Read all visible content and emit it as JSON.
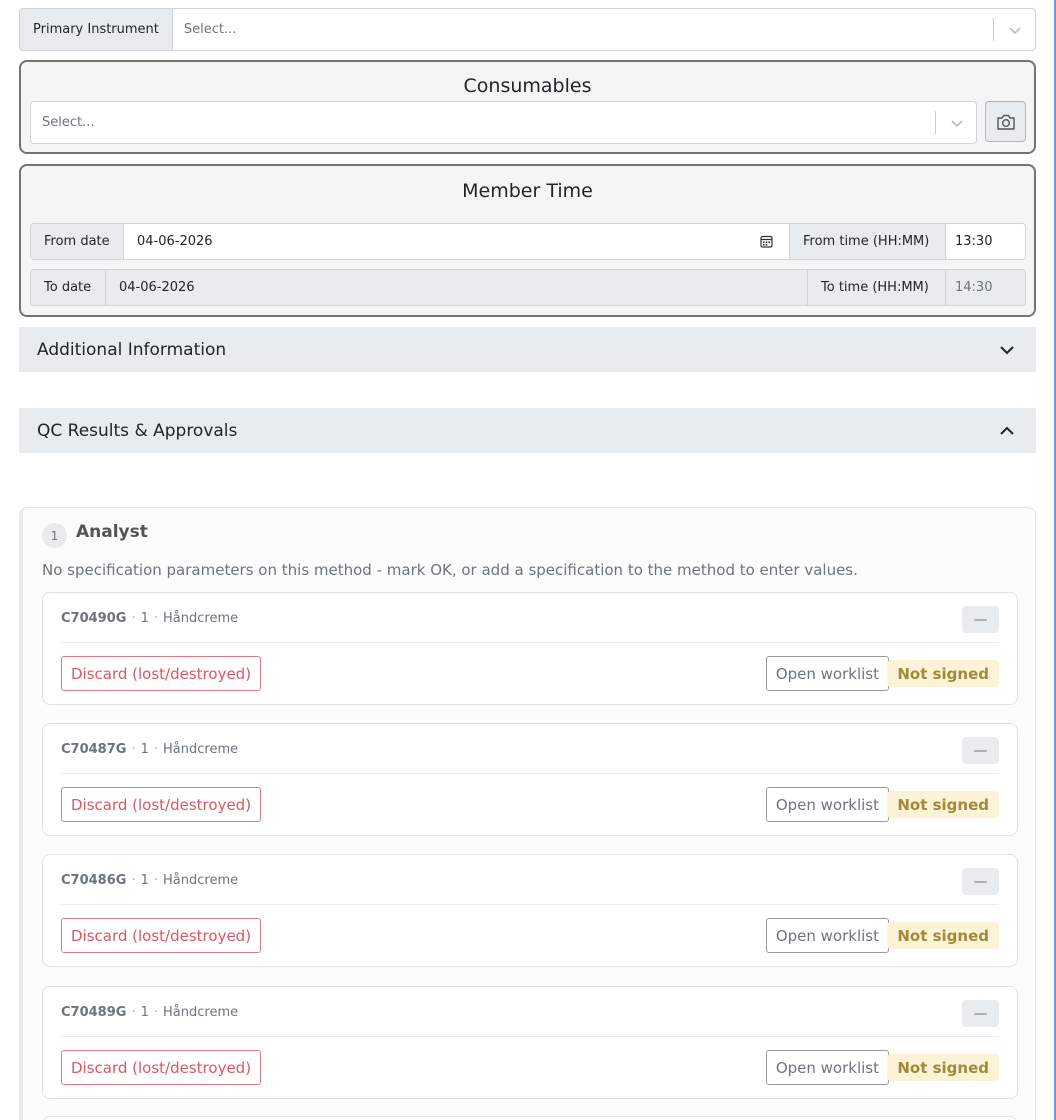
{
  "primary_instrument": {
    "label": "Primary Instrument",
    "placeholder": "Select..."
  },
  "consumables": {
    "title": "Consumables",
    "placeholder": "Select...",
    "camera_icon": "camera-icon"
  },
  "member_time": {
    "title": "Member Time",
    "from_date_label": "From date",
    "from_date_value": "04-06-2026",
    "from_time_label": "From time (HH:MM)",
    "from_time_value": "13:30",
    "to_date_label": "To date",
    "to_date_value": "04-06-2026",
    "to_time_label": "To time (HH:MM)",
    "to_time_value": "14:30"
  },
  "additional_info": {
    "title": "Additional Information",
    "expanded": false
  },
  "qc_results": {
    "title": "QC Results & Approvals",
    "expanded": true
  },
  "analyst": {
    "step": "1",
    "title": "Analyst",
    "hint": "No specification parameters on this method - mark OK, or add a specification to the method to enter values.",
    "samples": [
      {
        "code": "C70490G",
        "qty": "1",
        "product": "Håndcreme",
        "dash": "—",
        "discard_label": "Discard (lost/destroyed)",
        "worklist_label": "Open worklist",
        "status": "Not signed"
      },
      {
        "code": "C70487G",
        "qty": "1",
        "product": "Håndcreme",
        "dash": "—",
        "discard_label": "Discard (lost/destroyed)",
        "worklist_label": "Open worklist",
        "status": "Not signed"
      },
      {
        "code": "C70486G",
        "qty": "1",
        "product": "Håndcreme",
        "dash": "—",
        "discard_label": "Discard (lost/destroyed)",
        "worklist_label": "Open worklist",
        "status": "Not signed"
      },
      {
        "code": "C70489G",
        "qty": "1",
        "product": "Håndcreme",
        "dash": "—",
        "discard_label": "Discard (lost/destroyed)",
        "worklist_label": "Open worklist",
        "status": "Not signed"
      }
    ]
  },
  "colors": {
    "accent_edge": "#6c9bd2",
    "danger": "#e05563",
    "warning_bg": "#fcf3d7",
    "warning_text": "#a08a3b"
  }
}
